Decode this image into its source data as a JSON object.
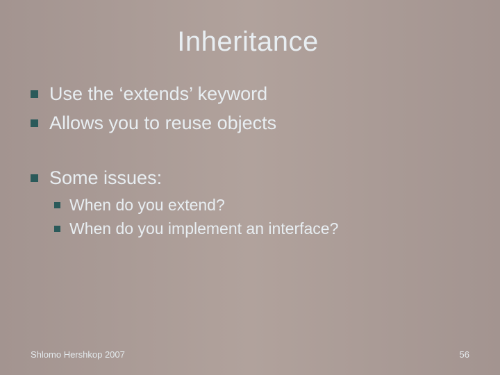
{
  "title": "Inheritance",
  "bullets": [
    {
      "text": "Use the ‘extends’ keyword"
    },
    {
      "text": "Allows you to reuse objects"
    },
    {
      "text": "Some issues:",
      "children": [
        {
          "text": "When do you extend?"
        },
        {
          "text": "When do you implement an interface?"
        }
      ]
    }
  ],
  "footer": {
    "left": "Shlomo Hershkop 2007",
    "right": "56"
  }
}
